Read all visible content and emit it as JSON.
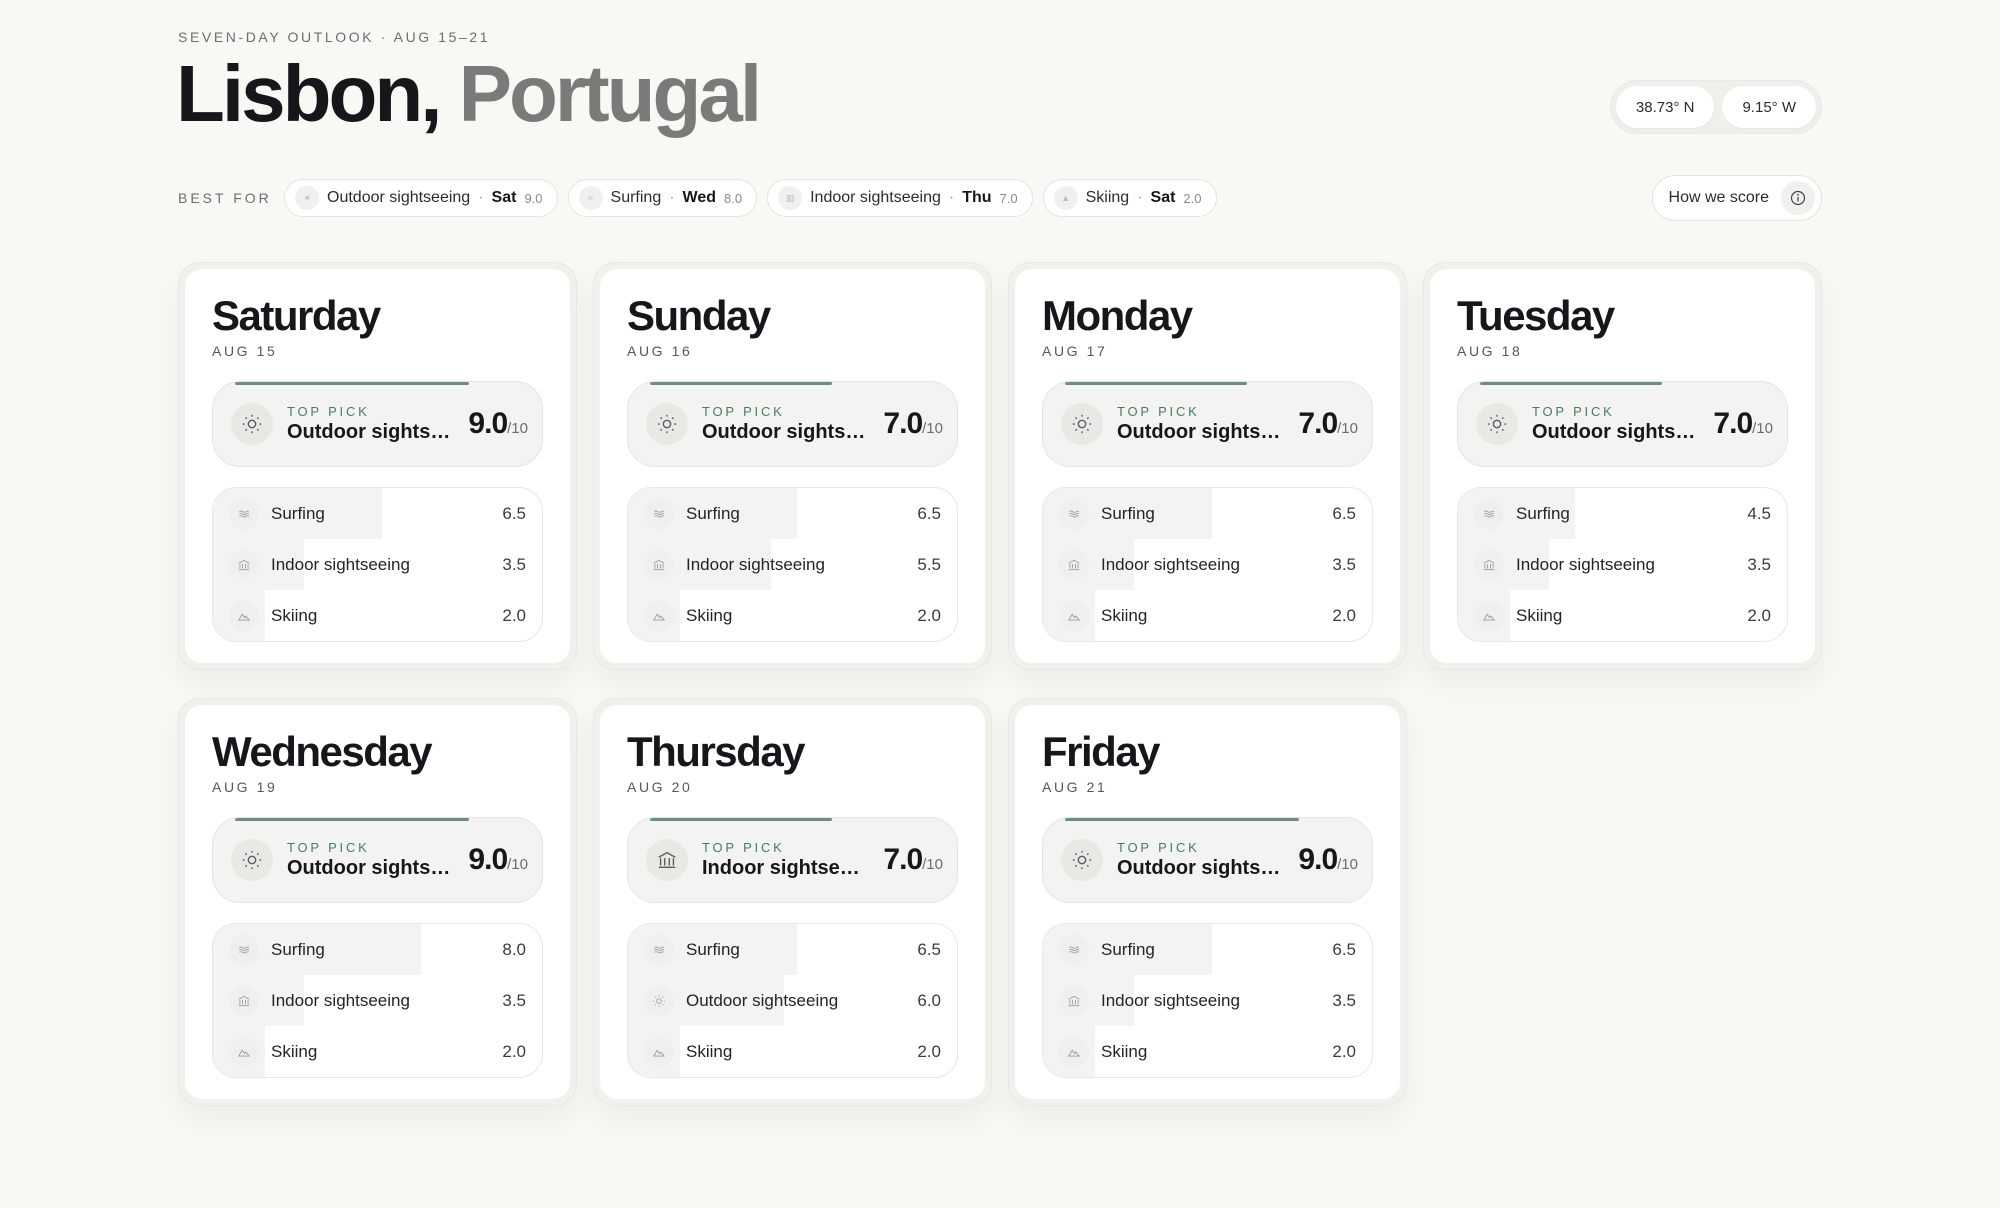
{
  "header": {
    "eyebrow": "SEVEN-DAY OUTLOOK · AUG 15–21",
    "city": "Lisbon,",
    "country": "Portugal",
    "lat": "38.73° N",
    "lon": "9.15° W"
  },
  "best_for": {
    "label": "BEST FOR",
    "chips": [
      {
        "activity": "Outdoor sightseeing",
        "day": "Sat",
        "score": "9.0"
      },
      {
        "activity": "Surfing",
        "day": "Wed",
        "score": "8.0"
      },
      {
        "activity": "Indoor sightseeing",
        "day": "Thu",
        "score": "7.0"
      },
      {
        "activity": "Skiing",
        "day": "Sat",
        "score": "2.0"
      }
    ],
    "how_we_score": "How we score"
  },
  "days": [
    {
      "name": "Saturday",
      "date": "AUG 15",
      "top": {
        "label": "TOP PICK",
        "name": "Outdoor sightseeing",
        "score": "9.0",
        "den": "/10",
        "icon": "sun-icon",
        "fraction": 0.9
      },
      "rows": [
        {
          "name": "Surfing",
          "score": "6.5",
          "icon": "waves-icon",
          "fraction": 0.65
        },
        {
          "name": "Indoor sightseeing",
          "score": "3.5",
          "icon": "museum-icon",
          "fraction": 0.35
        },
        {
          "name": "Skiing",
          "score": "2.0",
          "icon": "mountain-icon",
          "fraction": 0.2
        }
      ]
    },
    {
      "name": "Sunday",
      "date": "AUG 16",
      "top": {
        "label": "TOP PICK",
        "name": "Outdoor sightseeing",
        "score": "7.0",
        "den": "/10",
        "icon": "sun-icon",
        "fraction": 0.7
      },
      "rows": [
        {
          "name": "Surfing",
          "score": "6.5",
          "icon": "waves-icon",
          "fraction": 0.65
        },
        {
          "name": "Indoor sightseeing",
          "score": "5.5",
          "icon": "museum-icon",
          "fraction": 0.55
        },
        {
          "name": "Skiing",
          "score": "2.0",
          "icon": "mountain-icon",
          "fraction": 0.2
        }
      ]
    },
    {
      "name": "Monday",
      "date": "AUG 17",
      "top": {
        "label": "TOP PICK",
        "name": "Outdoor sightseeing",
        "score": "7.0",
        "den": "/10",
        "icon": "sun-icon",
        "fraction": 0.7
      },
      "rows": [
        {
          "name": "Surfing",
          "score": "6.5",
          "icon": "waves-icon",
          "fraction": 0.65
        },
        {
          "name": "Indoor sightseeing",
          "score": "3.5",
          "icon": "museum-icon",
          "fraction": 0.35
        },
        {
          "name": "Skiing",
          "score": "2.0",
          "icon": "mountain-icon",
          "fraction": 0.2
        }
      ]
    },
    {
      "name": "Tuesday",
      "date": "AUG 18",
      "top": {
        "label": "TOP PICK",
        "name": "Outdoor sightseeing",
        "score": "7.0",
        "den": "/10",
        "icon": "sun-icon",
        "fraction": 0.7
      },
      "rows": [
        {
          "name": "Surfing",
          "score": "4.5",
          "icon": "waves-icon",
          "fraction": 0.45
        },
        {
          "name": "Indoor sightseeing",
          "score": "3.5",
          "icon": "museum-icon",
          "fraction": 0.35
        },
        {
          "name": "Skiing",
          "score": "2.0",
          "icon": "mountain-icon",
          "fraction": 0.2
        }
      ]
    },
    {
      "name": "Wednesday",
      "date": "AUG 19",
      "top": {
        "label": "TOP PICK",
        "name": "Outdoor sightseeing",
        "score": "9.0",
        "den": "/10",
        "icon": "sun-icon",
        "fraction": 0.9
      },
      "rows": [
        {
          "name": "Surfing",
          "score": "8.0",
          "icon": "waves-icon",
          "fraction": 0.8
        },
        {
          "name": "Indoor sightseeing",
          "score": "3.5",
          "icon": "museum-icon",
          "fraction": 0.35
        },
        {
          "name": "Skiing",
          "score": "2.0",
          "icon": "mountain-icon",
          "fraction": 0.2
        }
      ]
    },
    {
      "name": "Thursday",
      "date": "AUG 20",
      "top": {
        "label": "TOP PICK",
        "name": "Indoor sightseeing",
        "score": "7.0",
        "den": "/10",
        "icon": "museum-icon",
        "fraction": 0.7
      },
      "rows": [
        {
          "name": "Surfing",
          "score": "6.5",
          "icon": "waves-icon",
          "fraction": 0.65
        },
        {
          "name": "Outdoor sightseeing",
          "score": "6.0",
          "icon": "sun-icon",
          "fraction": 0.6
        },
        {
          "name": "Skiing",
          "score": "2.0",
          "icon": "mountain-icon",
          "fraction": 0.2
        }
      ]
    },
    {
      "name": "Friday",
      "date": "AUG 21",
      "top": {
        "label": "TOP PICK",
        "name": "Outdoor sightseeing",
        "score": "9.0",
        "den": "/10",
        "icon": "sun-icon",
        "fraction": 0.9
      },
      "rows": [
        {
          "name": "Surfing",
          "score": "6.5",
          "icon": "waves-icon",
          "fraction": 0.65
        },
        {
          "name": "Indoor sightseeing",
          "score": "3.5",
          "icon": "museum-icon",
          "fraction": 0.35
        },
        {
          "name": "Skiing",
          "score": "2.0",
          "icon": "mountain-icon",
          "fraction": 0.2
        }
      ]
    }
  ],
  "colors": {
    "accent": "#6b8f7e",
    "top_pick_label": "#4e7a64",
    "country": "#7a7a78",
    "background": "#f9f8f5"
  }
}
